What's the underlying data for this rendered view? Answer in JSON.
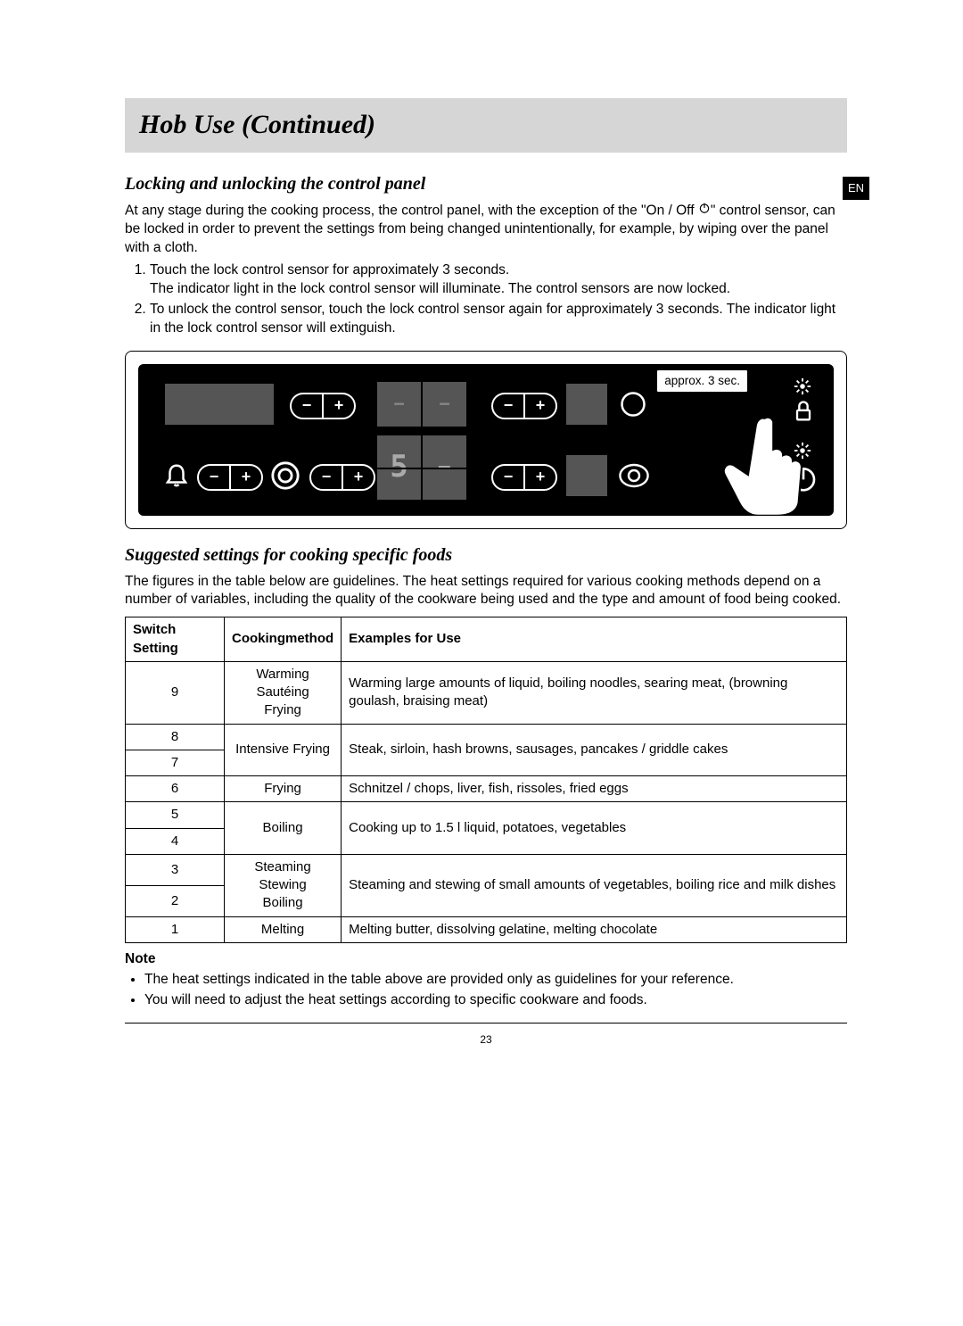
{
  "banner": {
    "title": "Hob Use (Continued)"
  },
  "lang_tab": "EN",
  "section_lock": {
    "heading": "Locking and unlocking the control panel",
    "intro_a": "At any stage during the cooking process, the control panel, with the exception of the \"On / Off ",
    "intro_b": "\" control sensor, can be locked in order to prevent the settings from being changed unintentionally, for example, by wiping over the panel with a cloth.",
    "steps": [
      "Touch the lock control sensor for approximately 3 seconds.\nThe indicator light in the lock control sensor will illuminate. The control sensors are now locked.",
      "To unlock the control sensor, touch the lock control sensor again for approximately 3 seconds. The indicator light in the lock control sensor will extinguish."
    ],
    "callout": "approx. 3 sec.",
    "digit": "5"
  },
  "section_settings": {
    "heading": "Suggested settings for cooking specific foods",
    "intro": "The figures in the table below are guidelines. The heat settings required for various cooking methods depend on a number of variables, including the quality of the cookware being used and the type and amount of food being cooked.",
    "headers": [
      "Switch Setting",
      "Cookingmethod",
      "Examples for Use"
    ],
    "rows": [
      {
        "settings": [
          "9"
        ],
        "method": "Warming\nSautéing\nFrying",
        "example": "Warming large amounts of liquid, boiling noodles, searing meat, (browning goulash, braising meat)"
      },
      {
        "settings": [
          "8",
          "7"
        ],
        "method": "Intensive Frying",
        "example": "Steak, sirloin, hash browns, sausages, pancakes / griddle cakes"
      },
      {
        "settings": [
          "6"
        ],
        "method": "Frying",
        "example": "Schnitzel / chops, liver, fish, rissoles, fried eggs"
      },
      {
        "settings": [
          "5",
          "4"
        ],
        "method": "Boiling",
        "example": "Cooking up to 1.5 l liquid, potatoes, vegetables"
      },
      {
        "settings": [
          "3",
          "2"
        ],
        "method": "Steaming\nStewing\nBoiling",
        "example": "Steaming and stewing of small amounts of vegetables, boiling rice and milk dishes"
      },
      {
        "settings": [
          "1"
        ],
        "method": "Melting",
        "example": "Melting butter, dissolving gelatine, melting chocolate"
      }
    ]
  },
  "note": {
    "heading": "Note",
    "items": [
      "The heat settings indicated in the table above are provided only as guidelines for your reference.",
      "You will need to adjust the heat settings according to specific cookware and foods."
    ]
  },
  "page_number": "23"
}
